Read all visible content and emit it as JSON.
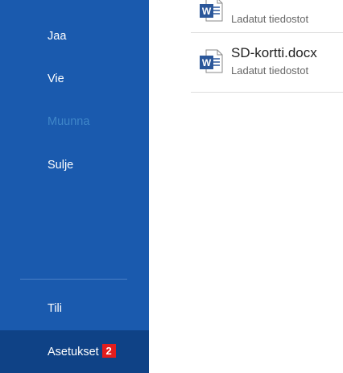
{
  "sidebar": {
    "items": [
      {
        "label": "Jaa"
      },
      {
        "label": "Vie"
      },
      {
        "label": "Muunna"
      },
      {
        "label": "Sulje"
      },
      {
        "label": "Tili"
      }
    ],
    "settings": {
      "label": "Asetukset",
      "badge": "2"
    }
  },
  "recent_files": [
    {
      "name": "",
      "location": "Ladatut tiedostot",
      "icon": "word-doc-icon"
    },
    {
      "name": "SD-kortti.docx",
      "location": "Ladatut tiedostot",
      "icon": "word-doc-icon"
    }
  ],
  "colors": {
    "sidebar_bg": "#1a5aae",
    "sidebar_selected_bg": "#0f4286",
    "disabled_text": "#3f86c9",
    "badge_red": "#e31d1d",
    "word_blue": "#2b579a"
  }
}
